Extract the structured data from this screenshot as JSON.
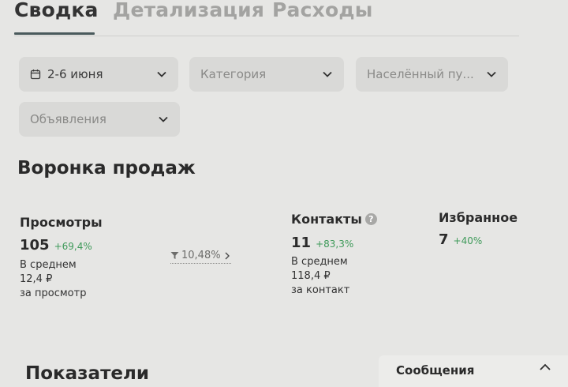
{
  "tabs": [
    "Сводка",
    "Детализация",
    "Расходы"
  ],
  "filters": {
    "date": "2-6 июня",
    "category": "Категория",
    "locality": "Населённый пу...",
    "ads": "Объявления"
  },
  "funnel": {
    "title": "Воронка продаж",
    "views": {
      "title": "Просмотры",
      "value": "105",
      "delta": "+69,4%",
      "avg_label": "В среднем",
      "avg_value": "12,4 ₽",
      "avg_unit": "за просмотр"
    },
    "conversion": "10,48%",
    "contacts": {
      "title": "Контакты",
      "help": "?",
      "value": "11",
      "delta": "+83,3%",
      "avg_label": "В среднем",
      "avg_value": "118,4 ₽",
      "avg_unit": "за контакт"
    },
    "favorites": {
      "title": "Избранное",
      "value": "7",
      "delta": "+40%"
    }
  },
  "indicators_title": "Показатели",
  "messages_label": "Сообщения",
  "colors": {
    "background": "#e6e6e4",
    "filter_bg": "#d9d9d7",
    "positive": "#3f9a5a",
    "tab_active_underline": "#4a5a5c"
  },
  "icons": [
    "calendar-icon",
    "chevron-down-icon",
    "funnel-icon",
    "chevron-right-icon",
    "help-icon",
    "chevron-up-icon"
  ]
}
